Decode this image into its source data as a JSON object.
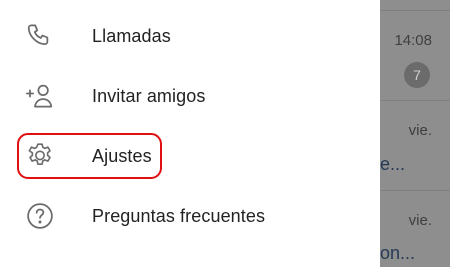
{
  "drawer": {
    "items": [
      {
        "label": "Llamadas",
        "icon": "phone-icon"
      },
      {
        "label": "Invitar amigos",
        "icon": "add-person-icon"
      },
      {
        "label": "Ajustes",
        "icon": "settings-gear-icon",
        "highlighted": true
      },
      {
        "label": "Preguntas frecuentes",
        "icon": "help-question-icon"
      }
    ]
  },
  "background_chats": {
    "row1": {
      "time": "14:08",
      "badge": "7"
    },
    "row2": {
      "time": "vie.",
      "snippet": "e..."
    },
    "row3": {
      "time": "vie.",
      "snippet": "on..."
    }
  },
  "colors": {
    "highlight": "#e01010",
    "icon": "#6b6b6b",
    "text": "#222222",
    "overlay": "#8e8e8e"
  }
}
